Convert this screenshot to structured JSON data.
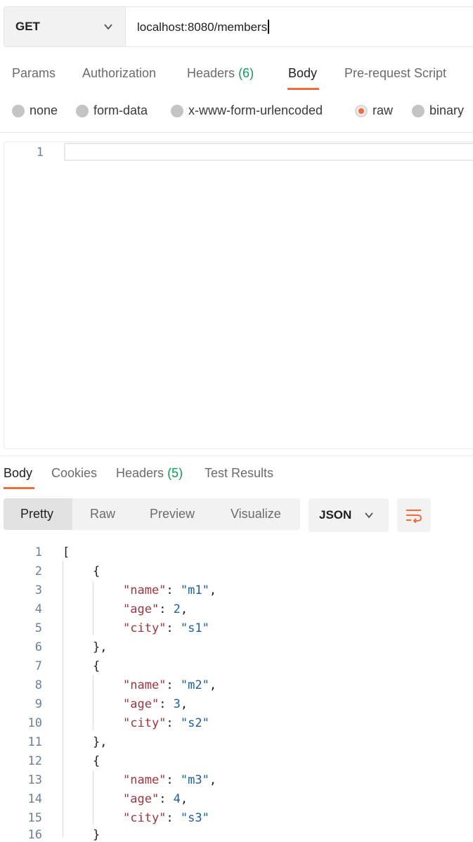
{
  "request": {
    "method": "GET",
    "url": "localhost:8080/members"
  },
  "request_tabs": [
    {
      "label": "Params"
    },
    {
      "label": "Authorization"
    },
    {
      "label": "Headers",
      "count": "(6)"
    },
    {
      "label": "Body"
    },
    {
      "label": "Pre-request Script"
    }
  ],
  "body_modes": [
    {
      "label": "none"
    },
    {
      "label": "form-data"
    },
    {
      "label": "x-www-form-urlencoded"
    },
    {
      "label": "raw"
    },
    {
      "label": "binary"
    }
  ],
  "request_editor": {
    "line_numbers": [
      "1"
    ]
  },
  "response_tabs": [
    {
      "label": "Body"
    },
    {
      "label": "Cookies"
    },
    {
      "label": "Headers",
      "count": "(5)"
    },
    {
      "label": "Test Results"
    }
  ],
  "format_tabs": [
    "Pretty",
    "Raw",
    "Preview",
    "Visualize"
  ],
  "language_select": "JSON",
  "colors": {
    "accent": "#f26b3a",
    "count_green": "#0f9d58",
    "json_key": "#a0343f",
    "json_value": "#1e5f9e"
  },
  "response_lines": [
    {
      "n": "1",
      "text": "["
    },
    {
      "n": "2",
      "text": "{"
    },
    {
      "n": "3",
      "key": "\"name\"",
      "sep": ": ",
      "val": "\"m1\"",
      "end": ","
    },
    {
      "n": "4",
      "key": "\"age\"",
      "sep": ": ",
      "val": "2",
      "end": ","
    },
    {
      "n": "5",
      "key": "\"city\"",
      "sep": ": ",
      "val": "\"s1\"",
      "end": ""
    },
    {
      "n": "6",
      "text": "},"
    },
    {
      "n": "7",
      "text": "{"
    },
    {
      "n": "8",
      "key": "\"name\"",
      "sep": ": ",
      "val": "\"m2\"",
      "end": ","
    },
    {
      "n": "9",
      "key": "\"age\"",
      "sep": ": ",
      "val": "3",
      "end": ","
    },
    {
      "n": "10",
      "key": "\"city\"",
      "sep": ": ",
      "val": "\"s2\"",
      "end": ""
    },
    {
      "n": "11",
      "text": "},"
    },
    {
      "n": "12",
      "text": "{"
    },
    {
      "n": "13",
      "key": "\"name\"",
      "sep": ": ",
      "val": "\"m3\"",
      "end": ","
    },
    {
      "n": "14",
      "key": "\"age\"",
      "sep": ": ",
      "val": "4",
      "end": ","
    },
    {
      "n": "15",
      "key": "\"city\"",
      "sep": ": ",
      "val": "\"s3\"",
      "end": ""
    },
    {
      "n": "16",
      "text": "}"
    }
  ]
}
